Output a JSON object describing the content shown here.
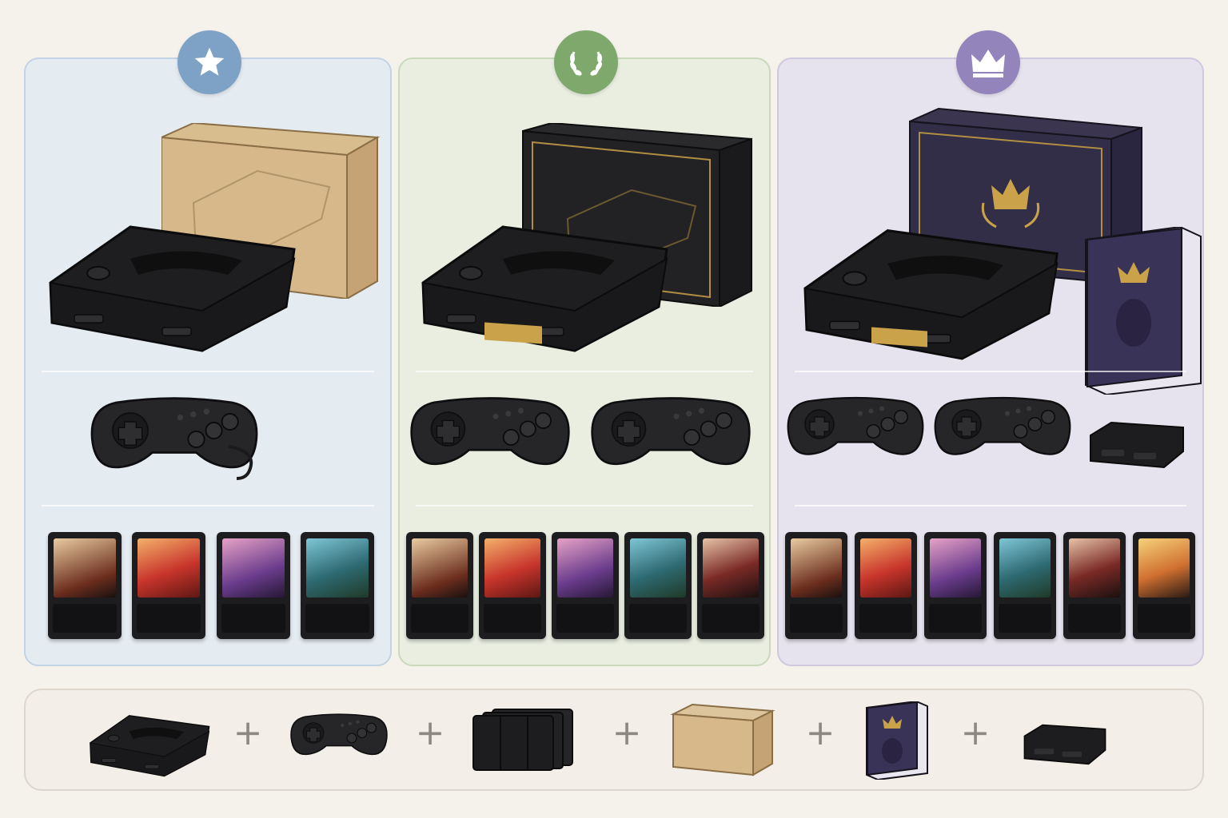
{
  "tiers": [
    {
      "id": "standard",
      "badge_icon": "star-icon",
      "badge_color": "#7ea2c6",
      "items": [
        "console",
        "cardboard-box",
        "controller"
      ],
      "controller_count": 1,
      "cartridge_count": 4,
      "cartridges": [
        "headband-fighter-portrait",
        "red-cap-fighter-portrait",
        "pink-hair-fighter-portrait",
        "armored-monster-portrait"
      ]
    },
    {
      "id": "deluxe",
      "badge_icon": "laurel-wreath-icon",
      "badge_color": "#7ea86c",
      "items": [
        "console-with-gold-plate",
        "black-gold-box",
        "controller",
        "controller"
      ],
      "controller_count": 2,
      "cartridge_count": 5,
      "cartridges": [
        "headband-fighter-portrait",
        "red-cap-fighter-portrait",
        "pink-hair-fighter-portrait",
        "armored-monster-portrait",
        "dark-hair-fighter-portrait"
      ]
    },
    {
      "id": "premium",
      "badge_icon": "crown-icon",
      "badge_color": "#9384bb",
      "items": [
        "console-with-gold-trim",
        "purple-crown-box",
        "art-book",
        "controller",
        "controller",
        "accessory-hub"
      ],
      "controller_count": 2,
      "cartridge_count": 6,
      "cartridges": [
        "headband-fighter-portrait",
        "red-cap-fighter-portrait",
        "pink-hair-fighter-portrait",
        "armored-monster-portrait",
        "dark-hair-fighter-portrait",
        "blond-fighter-portrait"
      ]
    }
  ],
  "legend": {
    "items": [
      "console-icon",
      "controller-icon",
      "cartridges-stack-icon",
      "shipping-box-icon",
      "art-book-icon",
      "accessory-hub-icon"
    ],
    "separator": "+"
  },
  "colors": {
    "background": "#f5f2ec",
    "standard_panel": "#e4ebf1",
    "deluxe_panel": "#e9eee1",
    "premium_panel": "#e6e3ee",
    "gold_accent": "#c9a24a",
    "hardware_black": "#222224"
  }
}
